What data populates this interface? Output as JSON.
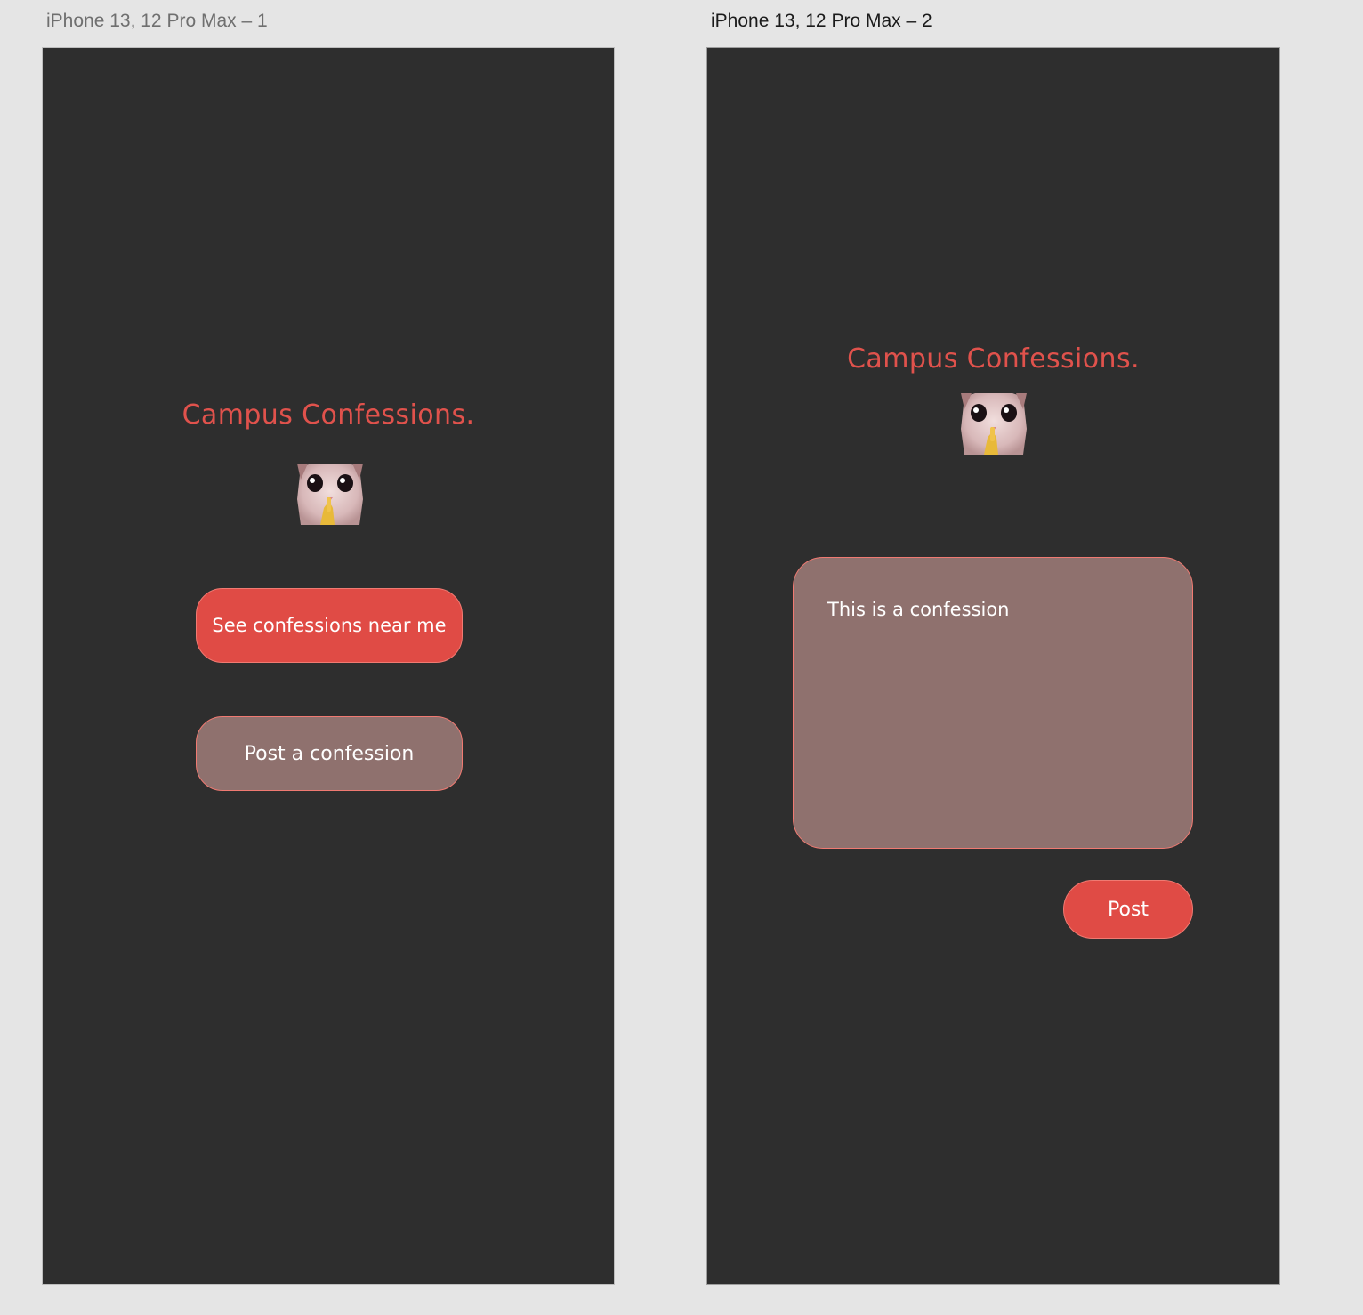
{
  "frames": [
    {
      "label": "iPhone 13, 12 Pro Max – 1",
      "app_title": "Campus Confessions.",
      "buttons": {
        "see_nearby": "See confessions near me",
        "post_confession": "Post a confession"
      }
    },
    {
      "label": "iPhone 13, 12 Pro Max – 2",
      "app_title": "Campus Confessions.",
      "confession_text": "This is a confession",
      "post_button": "Post"
    }
  ],
  "colors": {
    "canvas_bg": "#e5e5e5",
    "frame_bg": "#2e2e2e",
    "accent": "#e04b45",
    "title": "#e0524c",
    "secondary_button": "#8f716e",
    "button_border": "#f07a72",
    "button_text": "#ffffff"
  },
  "icons": {
    "mascot": "shushing-cat-icon"
  }
}
